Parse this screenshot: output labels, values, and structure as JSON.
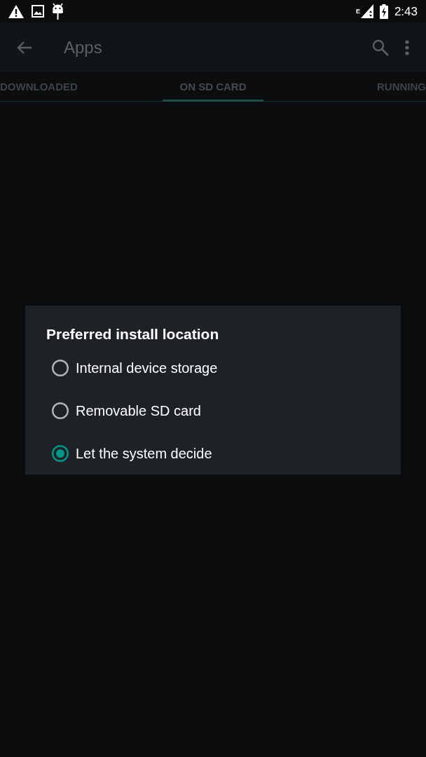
{
  "status_bar": {
    "network_type": "E",
    "time": "2:43"
  },
  "app_bar": {
    "title": "Apps"
  },
  "tabs": [
    {
      "label": "DOWNLOADED",
      "selected": false
    },
    {
      "label": "ON SD CARD",
      "selected": true
    },
    {
      "label": "RUNNING",
      "selected": false
    }
  ],
  "dialog": {
    "title": "Preferred install location",
    "options": [
      {
        "label": "Internal device storage",
        "selected": false
      },
      {
        "label": "Removable SD card",
        "selected": false
      },
      {
        "label": "Let the system decide",
        "selected": true
      }
    ]
  }
}
